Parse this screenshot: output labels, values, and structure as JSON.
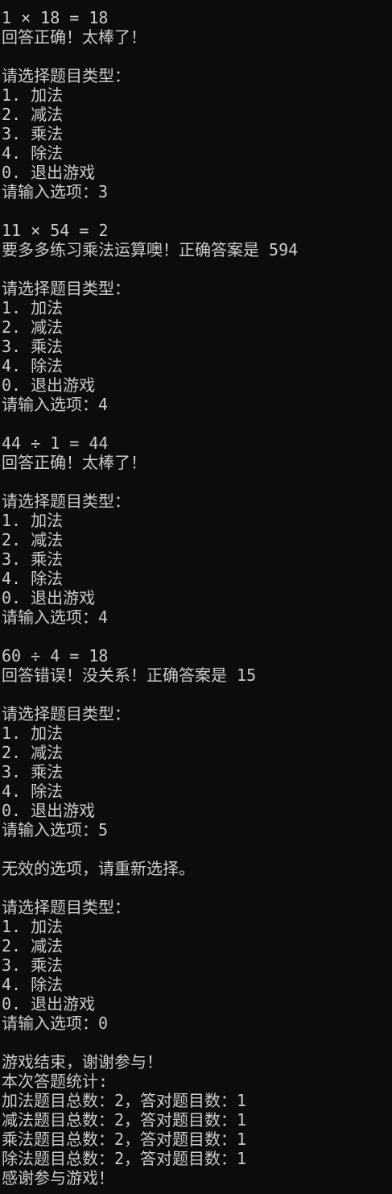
{
  "terminal": {
    "lines": [
      "1 × 18 = 18",
      "回答正确！太棒了！",
      "",
      "请选择题目类型：",
      "1. 加法",
      "2. 减法",
      "3. 乘法",
      "4. 除法",
      "0. 退出游戏",
      "请输入选项：3",
      "",
      "11 × 54 = 2",
      "要多多练习乘法运算噢！正确答案是 594",
      "",
      "请选择题目类型：",
      "1. 加法",
      "2. 减法",
      "3. 乘法",
      "4. 除法",
      "0. 退出游戏",
      "请输入选项：4",
      "",
      "44 ÷ 1 = 44",
      "回答正确！太棒了！",
      "",
      "请选择题目类型：",
      "1. 加法",
      "2. 减法",
      "3. 乘法",
      "4. 除法",
      "0. 退出游戏",
      "请输入选项：4",
      "",
      "60 ÷ 4 = 18",
      "回答错误！没关系！正确答案是 15",
      "",
      "请选择题目类型：",
      "1. 加法",
      "2. 减法",
      "3. 乘法",
      "4. 除法",
      "0. 退出游戏",
      "请输入选项：5",
      "",
      "无效的选项，请重新选择。",
      "",
      "请选择题目类型：",
      "1. 加法",
      "2. 减法",
      "3. 乘法",
      "4. 除法",
      "0. 退出游戏",
      "请输入选项：0",
      "",
      "游戏结束，谢谢参与！",
      "本次答题统计:",
      "加法题目总数：2，答对题目数：1",
      "减法题目总数：2，答对题目数：1",
      "乘法题目总数：2，答对题目数：1",
      "除法题目总数：2，答对题目数：1",
      "感谢参与游戏！"
    ]
  }
}
